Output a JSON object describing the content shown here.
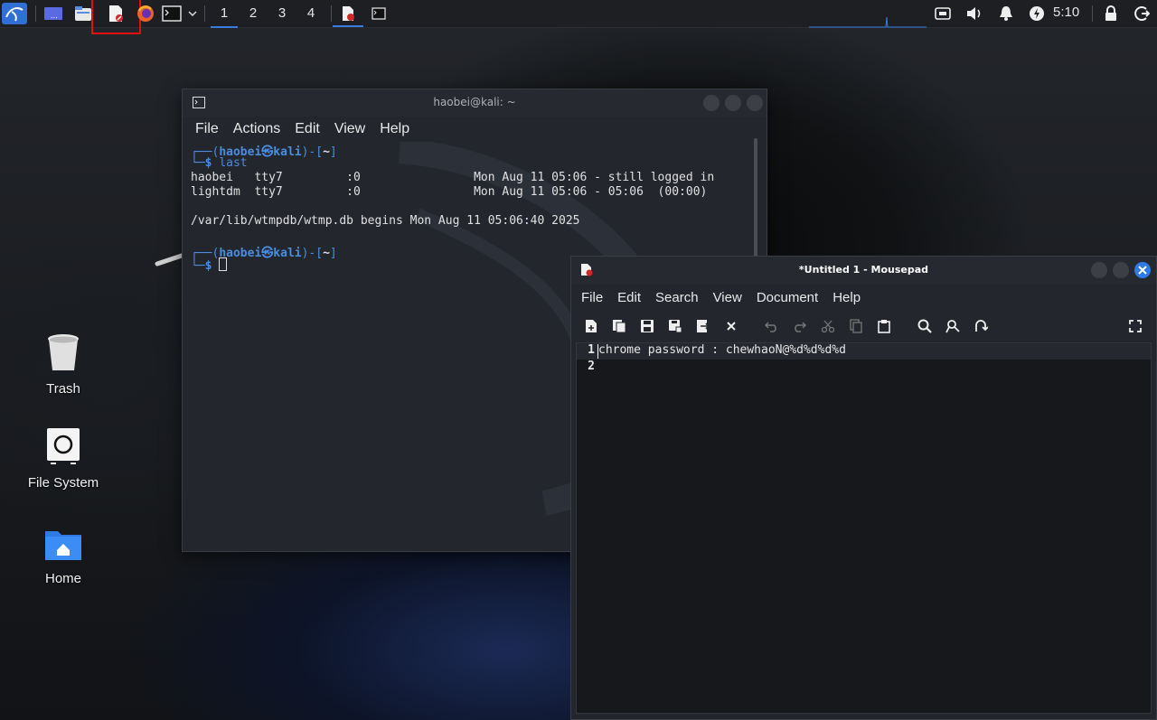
{
  "panel": {
    "workspaces": [
      "1",
      "2",
      "3",
      "4"
    ],
    "active_workspace": "1",
    "clock": "5:10",
    "icons": [
      "kali-menu-icon",
      "show-desktop-icon",
      "file-manager-icon",
      "mousepad-launcher-icon",
      "firefox-icon",
      "terminal-launcher-icon",
      "dropdown-icon",
      "mousepad-task-icon",
      "terminal-task-icon",
      "network-icon",
      "volume-icon",
      "notification-icon",
      "power-manager-icon",
      "lock-icon",
      "logout-icon"
    ]
  },
  "desktop": {
    "trash": "Trash",
    "filesystem": "File System",
    "home": "Home"
  },
  "terminal": {
    "title": "haobei@kali: ~",
    "menu": [
      "File",
      "Actions",
      "Edit",
      "View",
      "Help"
    ],
    "prompt_user": "haobei",
    "prompt_at": "㉿",
    "prompt_host": "kali",
    "prompt_dir": "~",
    "command": "last",
    "output": [
      "haobei   tty7         :0                Mon Aug 11 05:06 - still logged in",
      "lightdm  tty7         :0                Mon Aug 11 05:06 - 05:06  (00:00)",
      "",
      "/var/lib/wtmpdb/wtmp.db begins Mon Aug 11 05:06:40 2025"
    ]
  },
  "mousepad": {
    "title": "*Untitled 1 - Mousepad",
    "menu": [
      "File",
      "Edit",
      "Search",
      "View",
      "Document",
      "Help"
    ],
    "lines": [
      {
        "num": "1",
        "text": "chrome password : chewhaoN@%d%d%d%d"
      },
      {
        "num": "2",
        "text": ""
      }
    ]
  },
  "colors": {
    "accent": "#3a7be0",
    "prompt_blue": "#4a8de0",
    "highlight_red": "#e01010"
  }
}
